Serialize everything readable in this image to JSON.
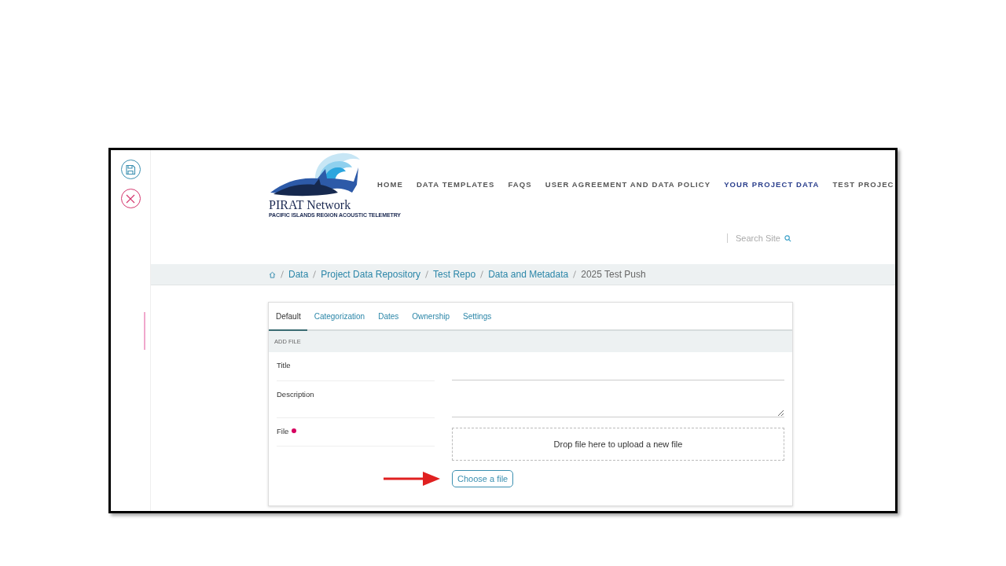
{
  "toolbar": {
    "buttons": [
      {
        "kind": "save"
      },
      {
        "kind": "cancel"
      }
    ]
  },
  "logo": {
    "name": "PIRAT Network",
    "tagline": "PACIFIC ISLANDS REGION ACOUSTIC TELEMETRY"
  },
  "nav": [
    {
      "label": "HOME",
      "selected": false
    },
    {
      "label": "DATA TEMPLATES",
      "selected": false
    },
    {
      "label": "FAQS",
      "selected": false
    },
    {
      "label": "USER AGREEMENT AND DATA POLICY",
      "selected": false
    },
    {
      "label": "YOUR PROJECT DATA",
      "selected": true
    },
    {
      "label": "TEST PROJEC",
      "selected": false
    }
  ],
  "search": {
    "placeholder": "Search Site"
  },
  "breadcrumb": [
    {
      "label": "Data",
      "current": false
    },
    {
      "label": "Project Data Repository",
      "current": false
    },
    {
      "label": "Test Repo",
      "current": false
    },
    {
      "label": "Data and Metadata",
      "current": false
    },
    {
      "label": "2025 Test Push",
      "current": true
    }
  ],
  "tabs": [
    {
      "label": "Default",
      "selected": true
    },
    {
      "label": "Categorization",
      "selected": false
    },
    {
      "label": "Dates",
      "selected": false
    },
    {
      "label": "Ownership",
      "selected": false
    },
    {
      "label": "Settings",
      "selected": false
    }
  ],
  "section": {
    "title": "ADD FILE"
  },
  "fields": [
    {
      "label": "Title",
      "kind": "input",
      "required": false
    },
    {
      "label": "Description",
      "kind": "textarea",
      "required": false
    },
    {
      "label": "File",
      "kind": "file",
      "required": true,
      "dropzone": "Drop file here to upload a new file",
      "button": "Choose a file"
    }
  ]
}
